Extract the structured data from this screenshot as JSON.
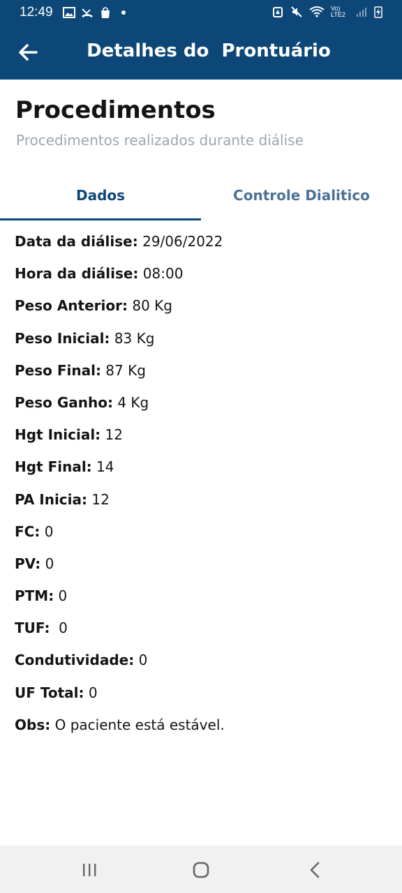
{
  "status_bar": {
    "time": "12:49",
    "network_label": "Vo) LTE2",
    "left_icons": [
      "image-icon",
      "missed-call-icon",
      "shopping-bag-icon",
      "dot-icon"
    ],
    "right_icons": [
      "alarm-icon",
      "mute-icon",
      "wifi-icon",
      "signal-icon",
      "battery-icon"
    ]
  },
  "app_bar": {
    "title": "Detalhes do  Prontuário",
    "back_icon": "arrow-left-icon",
    "color": "#0d4778"
  },
  "header": {
    "title": "Procedimentos",
    "subtitle": "Procedimentos realizados durante diálise"
  },
  "tabs": [
    {
      "label": "Dados",
      "selected": true
    },
    {
      "label": "Controle Dialitico",
      "selected": false
    }
  ],
  "fields": [
    {
      "label": "Data da diálise:",
      "value": " 29/06/2022"
    },
    {
      "label": "Hora da diálise:",
      "value": " 08:00"
    },
    {
      "label": "Peso Anterior:",
      "value": " 80 Kg"
    },
    {
      "label": "Peso Inicial:",
      "value": " 83 Kg"
    },
    {
      "label": "Peso Final:",
      "value": " 87 Kg"
    },
    {
      "label": "Peso Ganho:",
      "value": " 4 Kg"
    },
    {
      "label": "Hgt Inicial:",
      "value": " 12"
    },
    {
      "label": "Hgt Final:",
      "value": " 14"
    },
    {
      "label": "PA Inicia:",
      "value": " 12"
    },
    {
      "label": "FC:",
      "value": " 0"
    },
    {
      "label": "PV:",
      "value": " 0"
    },
    {
      "label": "PTM:",
      "value": " 0"
    },
    {
      "label": "TUF:",
      "value": "  0"
    },
    {
      "label": "Condutividade:",
      "value": " 0"
    },
    {
      "label": "UF Total:",
      "value": " 0"
    },
    {
      "label": "Obs:",
      "value": " O paciente está estável."
    }
  ],
  "nav_bar": {
    "buttons": [
      "recent-apps-icon",
      "home-icon",
      "back-icon"
    ]
  }
}
